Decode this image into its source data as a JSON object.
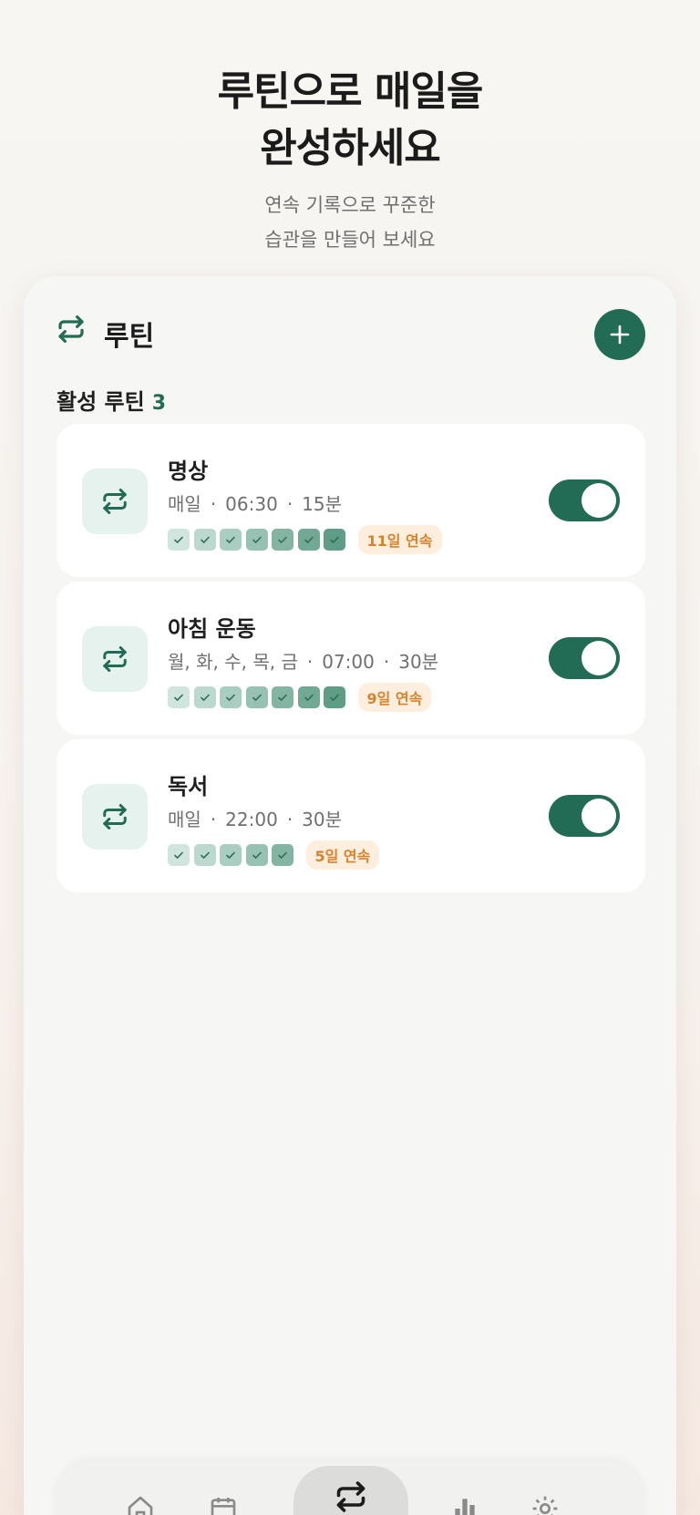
{
  "hero": {
    "title_line1": "루틴으로 매일을",
    "title_line2": "완성하세요",
    "sub_line1": "연속 기록으로 꾸준한",
    "sub_line2": "습관을 만들어 보세요"
  },
  "header": {
    "title": "루틴",
    "icon": "repeat-icon",
    "add_icon": "plus-icon"
  },
  "section": {
    "label": "활성 루틴",
    "count": "3"
  },
  "colors": {
    "accent": "#226b55",
    "icon_bg": "#e5f2ee",
    "streak_bg": "#fdeedd",
    "streak_text": "#d9822d"
  },
  "routines": [
    {
      "name": "명상",
      "schedule": "매일",
      "time": "06:30",
      "duration": "15분",
      "checks": 7,
      "streak": "11일 연속",
      "enabled": true
    },
    {
      "name": "아침 운동",
      "schedule": "월, 화, 수, 목, 금",
      "time": "07:00",
      "duration": "30분",
      "checks": 7,
      "streak": "9일 연속",
      "enabled": true
    },
    {
      "name": "독서",
      "schedule": "매일",
      "time": "22:00",
      "duration": "30분",
      "checks": 5,
      "streak": "5일 연속",
      "enabled": true
    }
  ],
  "tabs": [
    {
      "icon": "home-icon",
      "active": false
    },
    {
      "icon": "calendar-icon",
      "active": false
    },
    {
      "icon": "repeat-icon",
      "active": true
    },
    {
      "icon": "bar-chart-icon",
      "active": false
    },
    {
      "icon": "gear-icon",
      "active": false
    }
  ]
}
